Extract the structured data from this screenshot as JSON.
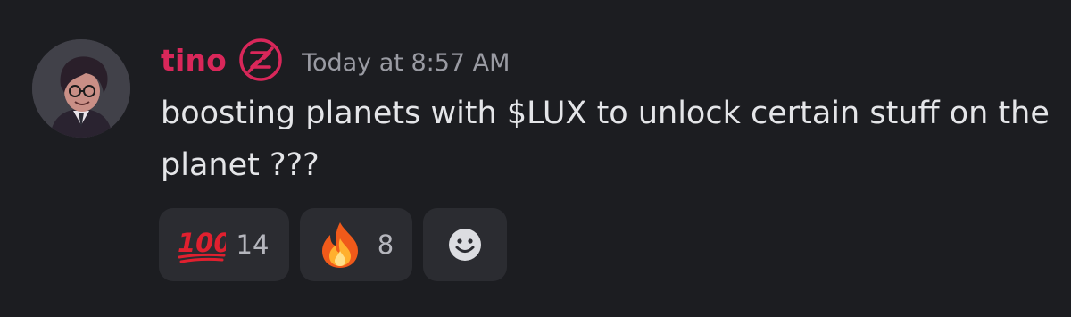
{
  "author": {
    "username": "tino",
    "username_color": "#d9275a"
  },
  "message": {
    "timestamp": "Today at 8:57 AM",
    "text": "boosting planets with $LUX to unlock certain stuff on the planet ???"
  },
  "reactions": [
    {
      "emoji": "💯",
      "icon": "hundred-points-emoji",
      "count": "14"
    },
    {
      "emoji": "🔥",
      "icon": "fire-emoji",
      "count": "8"
    }
  ],
  "add_reaction": {
    "icon": "smiley-face-icon"
  },
  "colors": {
    "background": "#1c1d21",
    "reaction_bg": "#2b2c31",
    "badge": "#d9275a"
  }
}
